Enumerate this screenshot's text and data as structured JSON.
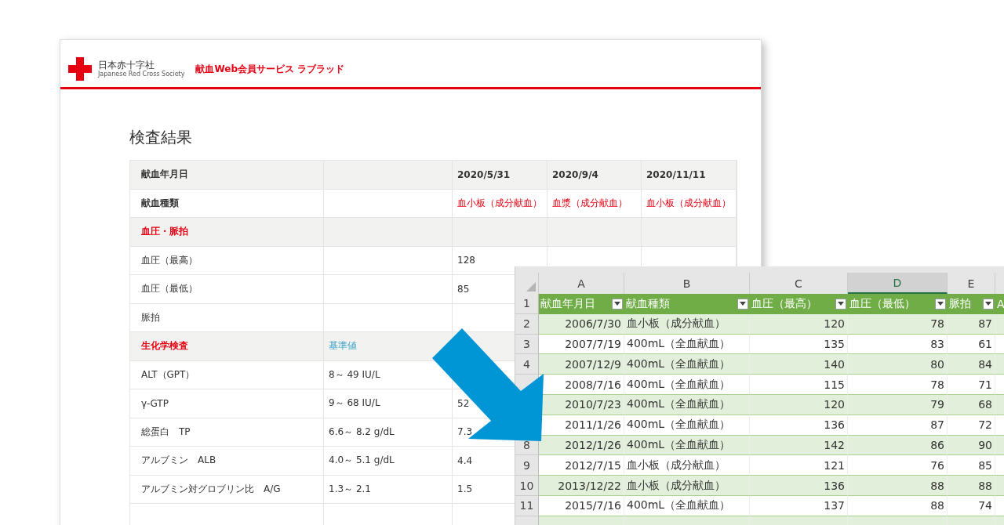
{
  "web_page": {
    "org_name": "日本赤十字社",
    "org_name_en": "Japanese Red Cross Society",
    "service": "献血Web会員サービス ラブラッド",
    "title": "検査結果",
    "rows": [
      {
        "kind": "header",
        "label": "献血年月日",
        "values": [
          "2020/5/31",
          "2020/9/4",
          "2020/11/11"
        ]
      },
      {
        "kind": "type",
        "label": "献血種類",
        "values": [
          "血小板（成分献血）",
          "血漿（成分献血）",
          "血小板（成分献血）"
        ]
      },
      {
        "kind": "section",
        "label": "血圧・脈拍"
      },
      {
        "kind": "item",
        "label": "血圧（最高）",
        "values": [
          "128"
        ]
      },
      {
        "kind": "item",
        "label": "血圧（最低）",
        "values": [
          "85"
        ]
      },
      {
        "kind": "item",
        "label": "脈拍"
      },
      {
        "kind": "section",
        "label": "生化学検査",
        "ref": "基準値"
      },
      {
        "kind": "item",
        "label": "ALT（GPT）",
        "ref": "8～ 49 IU/L"
      },
      {
        "kind": "item",
        "label": "γ-GTP",
        "ref": "9～ 68 IU/L",
        "values": [
          "52"
        ]
      },
      {
        "kind": "item",
        "label": "総蛋白　TP",
        "ref": "6.6～ 8.2 g/dL",
        "values": [
          "7.3"
        ]
      },
      {
        "kind": "item",
        "label": "アルブミン　ALB",
        "ref": "4.0～ 5.1 g/dL",
        "values": [
          "4.4"
        ]
      },
      {
        "kind": "item",
        "label": "アルブミン対グロブリン比　A/G",
        "ref": "1.3～ 2.1",
        "values": [
          "1.5"
        ]
      },
      {
        "kind": "item",
        "label": ""
      }
    ]
  },
  "spreadsheet": {
    "columns": [
      {
        "letter": "A",
        "header": "献血年月日",
        "selected": false
      },
      {
        "letter": "B",
        "header": "献血種類",
        "selected": false
      },
      {
        "letter": "C",
        "header": "血圧（最高）",
        "selected": false
      },
      {
        "letter": "D",
        "header": "血圧（最低）",
        "selected": true
      },
      {
        "letter": "E",
        "header": "脈拍",
        "selected": false
      },
      {
        "header": "A",
        "selected": false
      }
    ],
    "header_row": "1",
    "rows": [
      {
        "num": "2",
        "cells": [
          "2006/7/30",
          "血小板（成分献血）",
          "120",
          "78",
          "87"
        ]
      },
      {
        "num": "3",
        "cells": [
          "2007/7/19",
          "400mL（全血献血）",
          "135",
          "83",
          "61"
        ]
      },
      {
        "num": "4",
        "cells": [
          "2007/12/9",
          "400mL（全血献血）",
          "140",
          "80",
          "84"
        ]
      },
      {
        "cells": [
          "2008/7/16",
          "400mL（全血献血）",
          "115",
          "78",
          "71"
        ]
      },
      {
        "cells": [
          "2010/7/23",
          "400mL（全血献血）",
          "120",
          "79",
          "68"
        ]
      },
      {
        "cells": [
          "2011/1/26",
          "400mL（全血献血）",
          "136",
          "87",
          "72"
        ]
      },
      {
        "num": "8",
        "cells": [
          "2012/1/26",
          "400mL（全血献血）",
          "142",
          "86",
          "90"
        ]
      },
      {
        "num": "9",
        "cells": [
          "2012/7/15",
          "血小板（成分献血）",
          "121",
          "76",
          "85"
        ]
      },
      {
        "num": "10",
        "cells": [
          "2013/12/22",
          "血小板（成分献血）",
          "136",
          "88",
          "88"
        ]
      },
      {
        "num": "11",
        "cells": [
          "2015/7/16",
          "400mL（全血献血）",
          "137",
          "88",
          "74"
        ]
      },
      {
        "cells": []
      }
    ]
  }
}
